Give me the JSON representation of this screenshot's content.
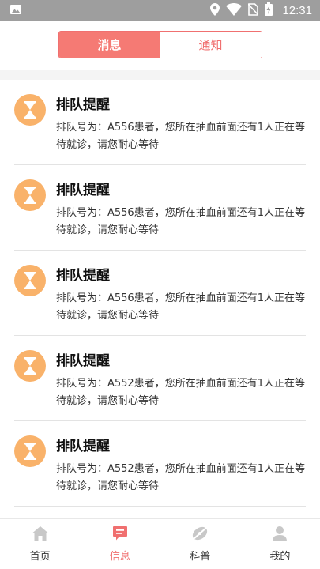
{
  "status_bar": {
    "time": "12:31",
    "icons": [
      "image-icon",
      "location-icon",
      "wifi-icon",
      "no-sim-icon",
      "battery-charging-icon"
    ]
  },
  "segment": {
    "messages_label": "消息",
    "notices_label": "通知",
    "active": "messages"
  },
  "messages": [
    {
      "title": "排队提醒",
      "body": "排队号为：A556患者，您所在抽血前面还有1人正在等待就诊，请您耐心等待",
      "icon": "hourglass-icon"
    },
    {
      "title": "排队提醒",
      "body": "排队号为：A556患者，您所在抽血前面还有1人正在等待就诊，请您耐心等待",
      "icon": "hourglass-icon"
    },
    {
      "title": "排队提醒",
      "body": "排队号为：A556患者，您所在抽血前面还有1人正在等待就诊，请您耐心等待",
      "icon": "hourglass-icon"
    },
    {
      "title": "排队提醒",
      "body": "排队号为：A552患者，您所在抽血前面还有1人正在等待就诊，请您耐心等待",
      "icon": "hourglass-icon"
    },
    {
      "title": "排队提醒",
      "body": "排队号为：A552患者，您所在抽血前面还有1人正在等待就诊，请您耐心等待",
      "icon": "hourglass-icon"
    }
  ],
  "tabbar": {
    "items": [
      {
        "label": "首页",
        "icon": "home-icon"
      },
      {
        "label": "信息",
        "icon": "message-icon"
      },
      {
        "label": "科普",
        "icon": "science-icon"
      },
      {
        "label": "我的",
        "icon": "profile-icon"
      }
    ],
    "active_index": 1
  },
  "colors": {
    "accent": "#f57a74",
    "avatar_bg": "#f9b26a",
    "status_bar": "#9e9e9e"
  }
}
